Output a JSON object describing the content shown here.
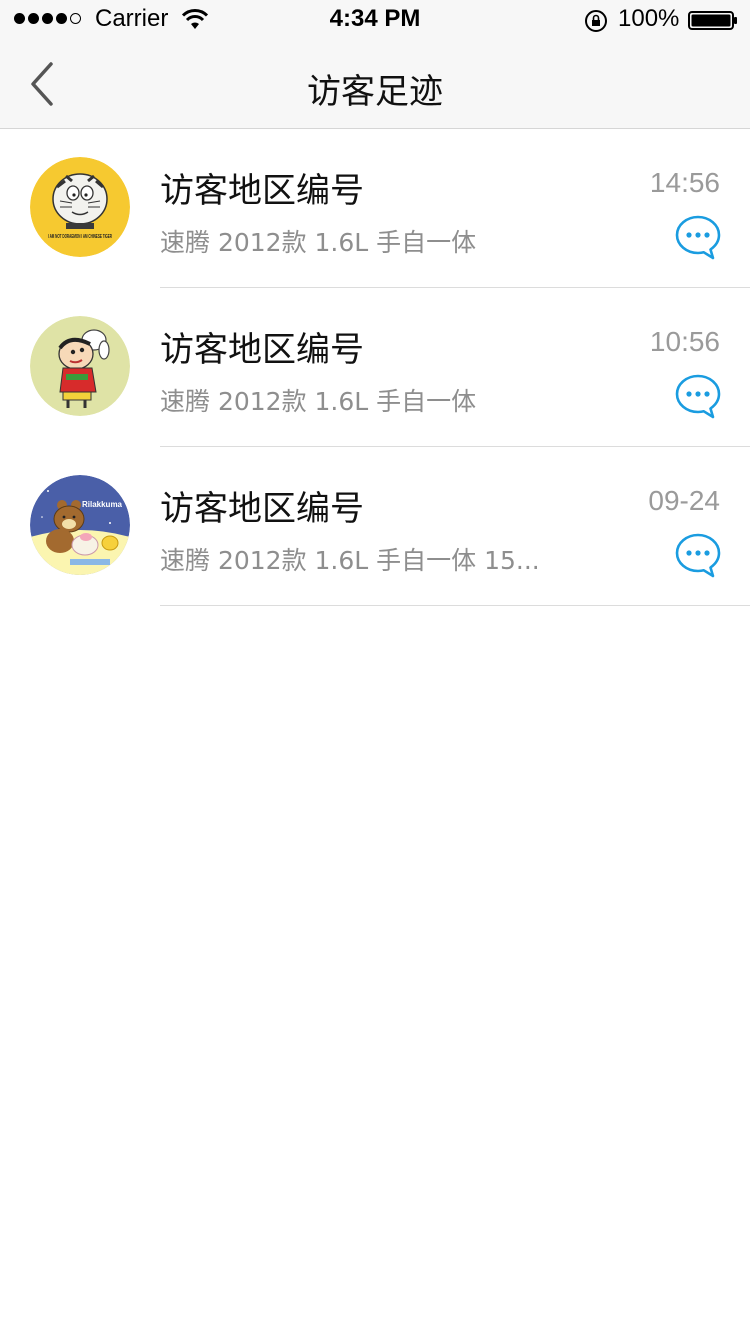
{
  "status_bar": {
    "carrier": "Carrier",
    "time": "4:34 PM",
    "battery": "100%"
  },
  "nav": {
    "title": "访客足迹"
  },
  "visitors": [
    {
      "name": "访客地区编号",
      "description": "速腾 2012款 1.6L 手自一体",
      "time": "14:56",
      "avatar_caption": "I AM NOT DORAEMON I AM CHINESE TIGER"
    },
    {
      "name": "访客地区编号",
      "description": "速腾 2012款 1.6L 手自一体",
      "time": "10:56"
    },
    {
      "name": "访客地区编号",
      "description": "速腾 2012款 1.6L 手自一体 15...",
      "time": "09-24",
      "avatar_caption": "Rilakkuma"
    }
  ],
  "colors": {
    "accent": "#1a9ce0",
    "nav_bg": "#f7f7f7",
    "divider": "#dcdcdc",
    "secondary_text": "#8e8e8e"
  }
}
